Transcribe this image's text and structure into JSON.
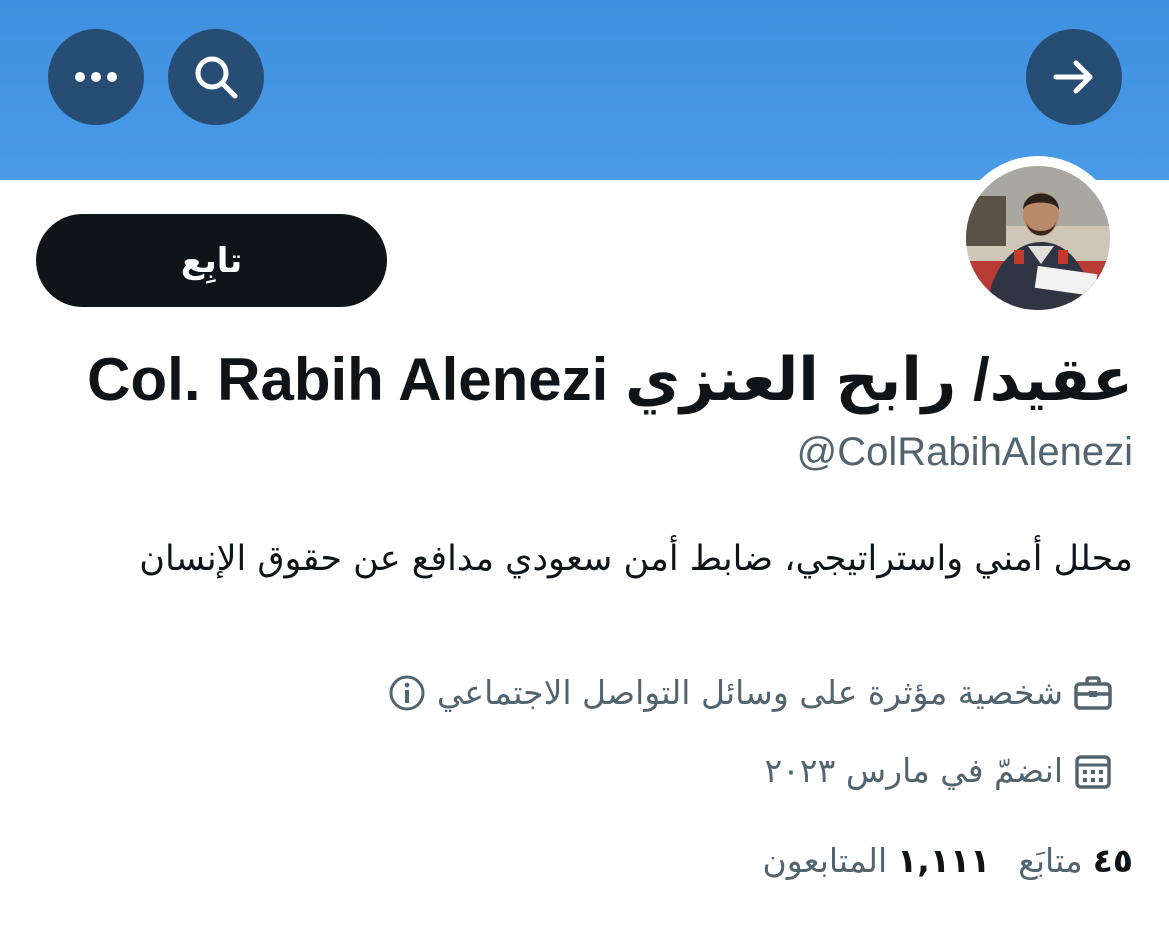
{
  "header": {
    "more_icon": "more-horizontal-icon",
    "search_icon": "search-icon",
    "back_icon": "arrow-right-icon",
    "banner_color": "#4a9be8",
    "button_color": "#274d75"
  },
  "profile": {
    "follow_label": "تابِع",
    "display_name": "عقيد/ رابح العنزي Col. Rabih Alenezi",
    "handle": "@ColRabihAlenezi",
    "bio": "محلل أمني واستراتيجي، ضابط أمن سعودي مدافع عن حقوق الإنسان",
    "category": "شخصية مؤثرة على وسائل التواصل الاجتماعي",
    "joined": "انضمّ في مارس ٢٠٢٣",
    "following_count": "٤٥",
    "following_label": "متابَع",
    "followers_count": "١,١١١",
    "followers_label": "المتابعون"
  }
}
